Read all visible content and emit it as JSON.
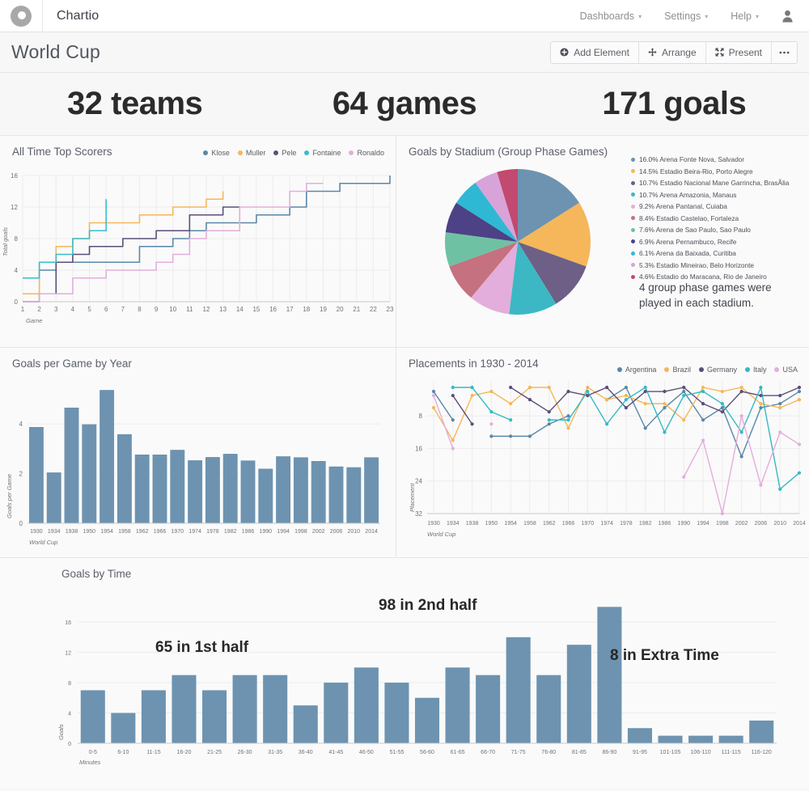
{
  "navbar": {
    "brand": "Chartio",
    "logo_icon": "chartio-donut-logo",
    "items": [
      {
        "label": "Dashboards",
        "icon": "chevron-down-icon"
      },
      {
        "label": "Settings",
        "icon": "chevron-down-icon"
      },
      {
        "label": "Help",
        "icon": "chevron-down-icon"
      }
    ],
    "avatar_icon": "user-avatar-icon"
  },
  "page": {
    "title": "World Cup",
    "toolbar": [
      {
        "label": "Add Element",
        "icon": "plus-circle-icon"
      },
      {
        "label": "Arrange",
        "icon": "move-arrows-icon"
      },
      {
        "label": "Present",
        "icon": "expand-arrows-icon"
      },
      {
        "label": "•••",
        "icon": "ellipsis-icon"
      }
    ]
  },
  "stats": [
    {
      "value": "32 teams"
    },
    {
      "value": "64 games"
    },
    {
      "value": "171 goals"
    }
  ],
  "panels": {
    "scorers_title": "All Time Top Scorers",
    "stadium_title": "Goals by Stadium (Group Phase Games)",
    "stadium_note": "4 group phase games were played in each stadium.",
    "gpg_title": "Goals per Game by Year",
    "placements_title": "Placements in 1930 - 2014",
    "goalstime_title": "Goals by Time"
  },
  "colors": {
    "bar": "#6d93b0",
    "klose": "#5a87a8",
    "muller": "#f5b759",
    "pele": "#5b4f77",
    "fontaine": "#3bbccb",
    "ronaldo": "#e3aedb",
    "argentina": "#5a87a8",
    "brazil": "#f5b759",
    "germany": "#5b4f77",
    "italy": "#35b9c4",
    "usa": "#e3aedb"
  },
  "chart_data": [
    {
      "id": "all-time-top-scorers",
      "type": "line",
      "title": "All Time Top Scorers",
      "xlabel": "Game",
      "ylabel": "Total goals",
      "xlim": [
        1,
        23
      ],
      "ylim": [
        0,
        16
      ],
      "yticks": [
        0,
        4,
        8,
        12,
        16
      ],
      "xticks": [
        1,
        2,
        3,
        4,
        5,
        6,
        7,
        8,
        9,
        10,
        11,
        12,
        13,
        14,
        15,
        16,
        17,
        18,
        19,
        20,
        21,
        22,
        23
      ],
      "grid": true,
      "legend_position": "top-right",
      "series": [
        {
          "name": "Klose",
          "color": "#5a87a8",
          "x": [
            1,
            2,
            3,
            4,
            5,
            6,
            7,
            8,
            9,
            10,
            11,
            12,
            13,
            14,
            15,
            16,
            17,
            18,
            19,
            20,
            21,
            22,
            23
          ],
          "values": [
            3,
            4,
            5,
            5,
            5,
            5,
            5,
            7,
            7,
            8,
            9,
            10,
            10,
            10,
            11,
            11,
            12,
            14,
            14,
            15,
            15,
            15,
            16
          ]
        },
        {
          "name": "Muller",
          "color": "#f5b759",
          "x": [
            1,
            2,
            3,
            4,
            5,
            6,
            7,
            8,
            9,
            10,
            11,
            12,
            13
          ],
          "values": [
            1,
            5,
            7,
            8,
            10,
            10,
            10,
            11,
            11,
            12,
            12,
            13,
            14
          ]
        },
        {
          "name": "Pele",
          "color": "#5b4f77",
          "x": [
            1,
            2,
            3,
            4,
            5,
            6,
            7,
            8,
            9,
            10,
            11,
            12,
            13,
            14
          ],
          "values": [
            0,
            1,
            5,
            6,
            7,
            7,
            8,
            8,
            9,
            9,
            11,
            11,
            12,
            12
          ]
        },
        {
          "name": "Fontaine",
          "color": "#3bbccb",
          "x": [
            1,
            2,
            3,
            4,
            5,
            6
          ],
          "values": [
            3,
            5,
            6,
            8,
            9,
            13
          ]
        },
        {
          "name": "Ronaldo",
          "color": "#e3aedb",
          "x": [
            1,
            2,
            3,
            4,
            5,
            6,
            7,
            8,
            9,
            10,
            11,
            12,
            13,
            14,
            15,
            16,
            17,
            18,
            19
          ],
          "values": [
            0,
            1,
            1,
            3,
            3,
            4,
            4,
            4,
            5,
            6,
            8,
            9,
            9,
            12,
            12,
            12,
            14,
            15,
            15
          ]
        }
      ]
    },
    {
      "id": "goals-by-stadium",
      "type": "pie",
      "title": "Goals by Stadium (Group Phase Games)",
      "legend_position": "right",
      "slices": [
        {
          "label": "Arena Fonte Nova, Salvador",
          "percent": 16.0,
          "color": "#6d93b0"
        },
        {
          "label": "Estadio Beira-Rio, Porto Alegre",
          "percent": 14.5,
          "color": "#f5b759"
        },
        {
          "label": "Estadio Nacional Mane Garrincha, BrasÃlia",
          "percent": 10.7,
          "color": "#6d5f86"
        },
        {
          "label": "Arena Amazonia, Manaus",
          "percent": 10.7,
          "color": "#3bb8c3"
        },
        {
          "label": "Arena Pantanal, Cuiaba",
          "percent": 9.2,
          "color": "#e3aedb"
        },
        {
          "label": "Estadio Castelao, Fortaleza",
          "percent": 8.4,
          "color": "#c5717f"
        },
        {
          "label": "Arena de Sao Paulo, Sao Paulo",
          "percent": 7.6,
          "color": "#6fc1a3"
        },
        {
          "label": "Arena Pernambuco, Recife",
          "percent": 6.9,
          "color": "#4c4285"
        },
        {
          "label": "Arena da Baixada, Curitiba",
          "percent": 6.1,
          "color": "#2fb8d4"
        },
        {
          "label": "Estadio Mineirao, Belo Horizonte",
          "percent": 5.3,
          "color": "#d8a3d8"
        },
        {
          "label": "Estadio do Maracana, Rio de Janeiro",
          "percent": 4.6,
          "color": "#c2496f"
        }
      ]
    },
    {
      "id": "goals-per-game-by-year",
      "type": "bar",
      "title": "Goals per Game by Year",
      "xlabel": "World Cup",
      "ylabel": "Goals per Game",
      "ylim": [
        0,
        5.6
      ],
      "yticks": [
        0,
        2,
        4
      ],
      "categories": [
        "1930",
        "1934",
        "1938",
        "1950",
        "1954",
        "1958",
        "1962",
        "1966",
        "1970",
        "1974",
        "1978",
        "1982",
        "1986",
        "1990",
        "1994",
        "1998",
        "2002",
        "2006",
        "2010",
        "2014"
      ],
      "values": [
        3.89,
        2.06,
        4.67,
        4.0,
        5.38,
        3.6,
        2.78,
        2.78,
        2.97,
        2.55,
        2.68,
        2.81,
        2.54,
        2.21,
        2.71,
        2.67,
        2.52,
        2.3,
        2.27,
        2.67
      ]
    },
    {
      "id": "placements-1930-2014",
      "type": "line",
      "title": "Placements in 1930 - 2014",
      "xlabel": "World Cup",
      "ylabel": "Placement",
      "ylim": [
        1,
        32
      ],
      "y_inverted": true,
      "yticks": [
        8,
        16,
        24,
        32
      ],
      "categories": [
        "1930",
        "1934",
        "1938",
        "1950",
        "1954",
        "1958",
        "1962",
        "1966",
        "1970",
        "1974",
        "1978",
        "1982",
        "1986",
        "1990",
        "1994",
        "1998",
        "2002",
        "2006",
        "2010",
        "2014"
      ],
      "legend_position": "top-right",
      "series": [
        {
          "name": "Argentina",
          "color": "#5a87a8",
          "values": [
            2,
            9,
            null,
            13,
            13,
            13,
            10,
            8,
            null,
            4,
            1,
            11,
            6,
            2,
            9,
            6,
            18,
            6,
            5,
            2
          ]
        },
        {
          "name": "Brazil",
          "color": "#f5b759",
          "values": [
            6,
            14,
            3,
            2,
            5,
            1,
            1,
            11,
            1,
            4,
            3,
            5,
            5,
            9,
            1,
            2,
            1,
            5,
            6,
            4
          ]
        },
        {
          "name": "Germany",
          "color": "#5b4f77",
          "values": [
            null,
            3,
            10,
            null,
            1,
            4,
            7,
            2,
            3,
            1,
            6,
            2,
            2,
            1,
            5,
            7,
            2,
            3,
            3,
            1
          ]
        },
        {
          "name": "Italy",
          "color": "#35b9c4",
          "values": [
            null,
            1,
            1,
            7,
            9,
            null,
            9,
            9,
            2,
            10,
            4,
            1,
            12,
            3,
            2,
            5,
            12,
            1,
            26,
            22
          ]
        },
        {
          "name": "USA",
          "color": "#e3aedb",
          "values": [
            3,
            16,
            null,
            10,
            null,
            null,
            null,
            null,
            null,
            null,
            null,
            null,
            null,
            23,
            14,
            32,
            8,
            25,
            12,
            15
          ]
        }
      ]
    },
    {
      "id": "goals-by-time",
      "type": "bar",
      "title": "Goals by Time",
      "xlabel": "Minutes",
      "ylabel": "Goals",
      "ylim": [
        0,
        19
      ],
      "yticks": [
        0,
        4,
        8,
        12,
        16
      ],
      "categories": [
        "0-5",
        "6-10",
        "11-15",
        "16-20",
        "21-25",
        "26-30",
        "31-35",
        "36-40",
        "41-45",
        "46-50",
        "51-55",
        "56-60",
        "61-65",
        "66-70",
        "71-75",
        "76-80",
        "81-85",
        "86-90",
        "91-95",
        "101-105",
        "106-110",
        "111-115",
        "116-120"
      ],
      "values": [
        7,
        4,
        7,
        9,
        7,
        9,
        9,
        5,
        8,
        10,
        8,
        6,
        10,
        9,
        14,
        9,
        13,
        18,
        2,
        1,
        1,
        1,
        3
      ],
      "annotations": [
        {
          "text": "65 in 1st half",
          "at_category": "26-30"
        },
        {
          "text": "98 in 2nd half",
          "at_category": "66-70"
        },
        {
          "text": "8 in Extra Time",
          "at_category": "106-110"
        }
      ]
    }
  ]
}
